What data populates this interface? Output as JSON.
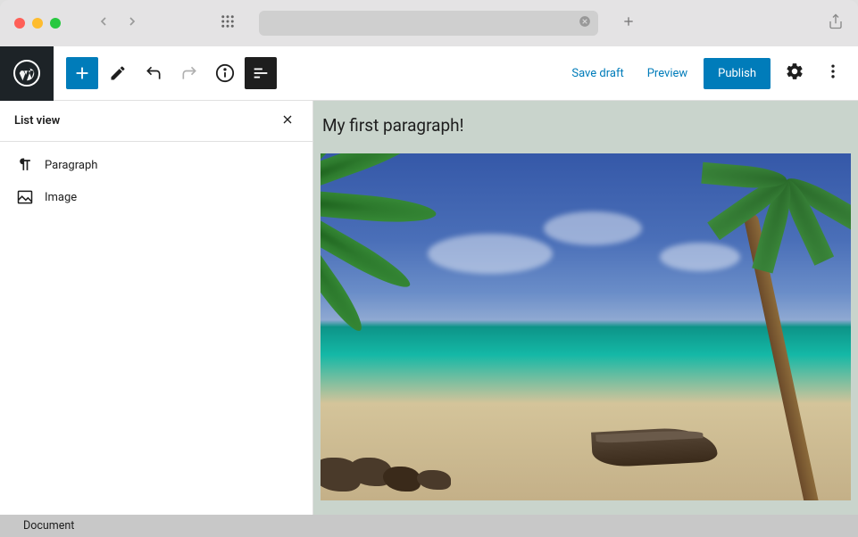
{
  "titlebar": {
    "nav_back": "‹",
    "nav_forward": "›"
  },
  "toolbar": {
    "save_draft": "Save draft",
    "preview": "Preview",
    "publish": "Publish"
  },
  "listview": {
    "title": "List view",
    "items": [
      {
        "label": "Paragraph",
        "icon": "paragraph-icon"
      },
      {
        "label": "Image",
        "icon": "image-icon"
      }
    ]
  },
  "canvas": {
    "paragraph_text": "My first paragraph!"
  },
  "footer": {
    "breadcrumb": "Document"
  },
  "colors": {
    "wp_blue": "#007cba",
    "wp_dark": "#1d2327"
  }
}
